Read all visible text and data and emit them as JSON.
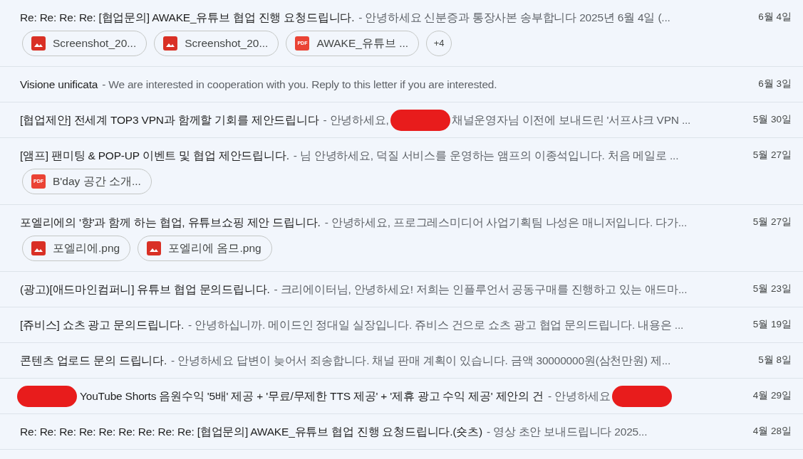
{
  "messages": [
    {
      "subject": "Re: Re: Re: Re: [협업문의] AWAKE_유튜브 협업 진행 요청드립니다.",
      "snippet": "- 안녕하세요 신분증과 통장사본 송부합니다 2025년 6월 4일 (...",
      "date": "6월 4일",
      "attachments": [
        {
          "kind": "image",
          "name": "Screenshot_20..."
        },
        {
          "kind": "image",
          "name": "Screenshot_20..."
        },
        {
          "kind": "pdf",
          "badge": "PDF",
          "name": "AWAKE_유튜브 ..."
        }
      ],
      "more": "+4"
    },
    {
      "subject": "Visione unificata",
      "snippet": "- We are interested in cooperation with you. Reply to this letter if you are interested.",
      "date": "6월 3일"
    },
    {
      "subject": "[협업제안] 전세계 TOP3 VPN과 함께할 기회를 제안드립니다",
      "snippet": "- 안녕하세요,",
      "redacted_after_snippet": true,
      "snippet_after": "채널운영자님 이전에 보내드린 '서프샤크 VPN ...",
      "date": "5월 30일"
    },
    {
      "subject": "[앰프] 팬미팅 & POP-UP 이벤트 및 협업 제안드립니다.",
      "snippet": "- 님 안녕하세요, 덕질 서비스를 운영하는 앰프의 이종석입니다. 처음 메일로 ...",
      "date": "5월 27일",
      "attachments": [
        {
          "kind": "pdf",
          "badge": "PDF",
          "name": "B'day 공간 소개..."
        }
      ]
    },
    {
      "subject": "포엘리에의 '향'과 함께 하는 협업, 유튜브쇼핑 제안 드립니다.",
      "snippet": "- 안녕하세요, 프로그레스미디어 사업기획팀 나성은 매니저입니다. 다가...",
      "date": "5월 27일",
      "attachments": [
        {
          "kind": "image",
          "name": "포엘리에.png"
        },
        {
          "kind": "image",
          "name": "포엘리에 옴므.png"
        }
      ]
    },
    {
      "subject": "(광고)[애드마인컴퍼니] 유튜브 협업 문의드립니다.",
      "snippet": "- 크리에이터님, 안녕하세요! 저희는 인플루언서 공동구매를 진행하고 있는 애드마...",
      "date": "5월 23일"
    },
    {
      "subject": "[쥬비스] 쇼츠 광고 문의드립니다.",
      "snippet": "- 안녕하십니까. 메이드인 정대일 실장입니다. 쥬비스 건으로 쇼츠 광고 협업 문의드립니다. 내용은 ...",
      "date": "5월 19일"
    },
    {
      "subject": "콘텐츠 업로드 문의 드립니다.",
      "snippet": "- 안녕하세요 답변이 늦어서 죄송합니다. 채널 판매 계획이 있습니다. 금액 30000000원(삼천만원) 제...",
      "date": "5월 8일"
    },
    {
      "redacted_before_subject": true,
      "subject": "YouTube Shorts 음원수익 '5배' 제공 + '무료/무제한 TTS 제공' + '제휴 광고 수익 제공' 제안의 건",
      "snippet": "- 안녕하세요",
      "redacted_after_snippet": true,
      "date": "4월 29일"
    },
    {
      "subject": "Re: Re: Re: Re: Re: Re: Re: Re: Re: [협업문의] AWAKE_유튜브 협업 진행 요청드립니다.(숏츠)",
      "snippet": "- 영상 초안 보내드립니다 2025...",
      "date": "4월 28일"
    }
  ]
}
